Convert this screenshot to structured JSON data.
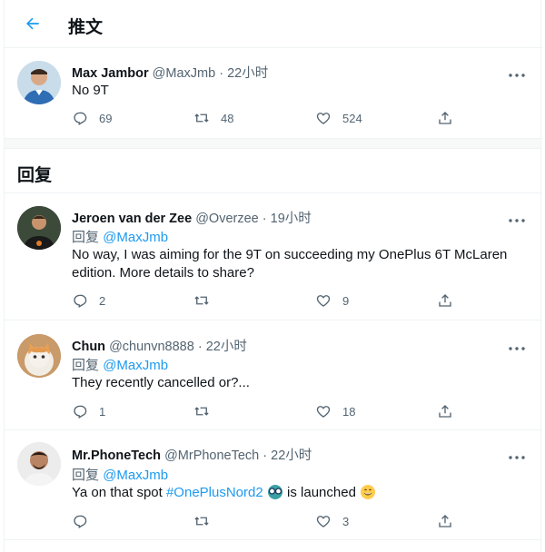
{
  "header": {
    "title": "推文"
  },
  "main_tweet": {
    "name": "Max Jambor",
    "handle": "@MaxJmb",
    "time": "22小时",
    "text": "No 9T",
    "replies": "69",
    "retweets": "48",
    "likes": "524"
  },
  "replies_section": {
    "title": "回复"
  },
  "replies": [
    {
      "name": "Jeroen van der Zee",
      "handle": "@Overzee",
      "time": "19小时",
      "reply_prefix": "回复",
      "reply_to": "@MaxJmb",
      "text": "No way, I was aiming for the 9T on succeeding my OnePlus 6T McLaren edition. More details to share?",
      "replies": "2",
      "retweets": "",
      "likes": "9"
    },
    {
      "name": "Chun",
      "handle": "@chunvn8888",
      "time": "22小时",
      "reply_prefix": "回复",
      "reply_to": "@MaxJmb",
      "text": "They recently cancelled or?...",
      "replies": "1",
      "retweets": "",
      "likes": "18"
    },
    {
      "name": "Mr.PhoneTech",
      "handle": "@MrPhoneTech",
      "time": "22小时",
      "reply_prefix": "回复",
      "reply_to": "@MaxJmb",
      "text_before": "Ya on that spot ",
      "hashtag": "#OnePlusNord2",
      "text_after": " is launched",
      "replies": "",
      "retweets": "",
      "likes": "3"
    }
  ],
  "colors": {
    "accent": "#1d9bf0",
    "secondary_text": "#536471",
    "border": "#eff3f4"
  }
}
